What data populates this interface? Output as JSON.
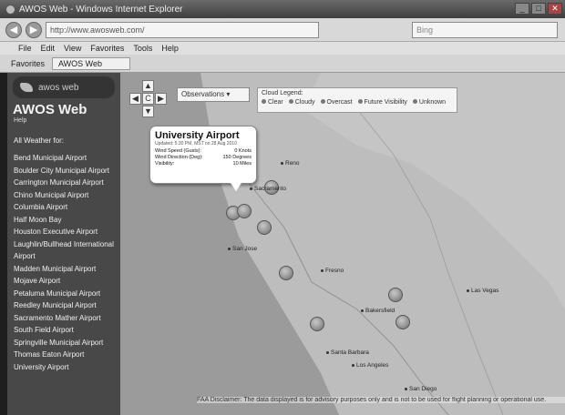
{
  "window": {
    "title": "AWOS Web - Windows Internet Explorer"
  },
  "addressbar": {
    "url": "http://www.awosweb.com/",
    "search_placeholder": "Bing"
  },
  "menubar": {
    "items": [
      "File",
      "Edit",
      "View",
      "Favorites",
      "Tools",
      "Help"
    ]
  },
  "favbar": {
    "favorites": "Favorites",
    "tab": "AWOS Web"
  },
  "sidebar": {
    "brand": "awos web",
    "title": "AWOS Web",
    "help": "Help",
    "all_weather": "All Weather for:",
    "airports": [
      "Bend Municipal Airport",
      "Boulder City Municipal Airport",
      "Carrington Municipal Airport",
      "Chino Municipal Airport",
      "Columbia Airport",
      "Half Moon Bay",
      "Houston Executive Airport",
      "Laughlin/Bullhead International Airport",
      "Madden Municipal Airport",
      "Mojave Airport",
      "Petaluma Municipal Airport",
      "Reedley Municipal Airport",
      "Sacramento Mather Airport",
      "South Field Airport",
      "Springville Municipal Airport",
      "Thomas Eaton Airport",
      "University Airport"
    ]
  },
  "map": {
    "observations_label": "Observations",
    "legend_title": "Cloud Legend:",
    "legend_items": [
      "Clear",
      "Cloudy",
      "Overcast",
      "Future Visibility",
      "Unknown"
    ],
    "disclaimer": "FAA Disclaimer: The data displayed is for advisory purposes only and is not to be used for flight planning or operational use.",
    "cities": [
      "San Jose",
      "Fresno",
      "Bakersfield",
      "Santa Barbara",
      "Los Angeles",
      "Las Vegas",
      "San Diego",
      "Reno",
      "Sacramento"
    ]
  },
  "infobox": {
    "title": "University Airport",
    "updated": "Updated: 5:30 PM, MST on 28 Aug 2010",
    "rows": [
      {
        "label": "Wind Speed (Gusts):",
        "value": "0 Knots"
      },
      {
        "label": "Wind Direction (Deg):",
        "value": "150 Degrees"
      },
      {
        "label": "Visibility:",
        "value": "10 Miles"
      }
    ]
  }
}
